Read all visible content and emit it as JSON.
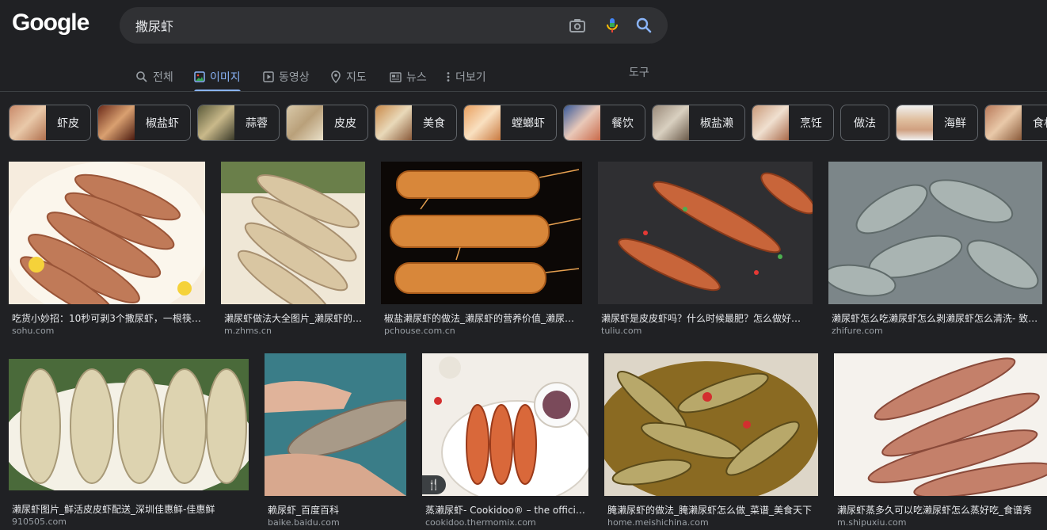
{
  "logo": "Google",
  "search": {
    "query": "撒尿虾"
  },
  "tabs": [
    {
      "label": "전체"
    },
    {
      "label": "이미지"
    },
    {
      "label": "동영상"
    },
    {
      "label": "지도"
    },
    {
      "label": "뉴스"
    },
    {
      "label": "더보기"
    }
  ],
  "tools": "도구",
  "chips": [
    {
      "label": "虾皮"
    },
    {
      "label": "椒盐虾"
    },
    {
      "label": "蒜蓉"
    },
    {
      "label": "皮皮"
    },
    {
      "label": "美食"
    },
    {
      "label": "螳螂虾"
    },
    {
      "label": "餐饮"
    },
    {
      "label": "椒盐濑"
    },
    {
      "label": "烹饪"
    },
    {
      "label": "做法"
    },
    {
      "label": "海鲜"
    },
    {
      "label": "食材"
    }
  ],
  "results": [
    {
      "title": "吃货小妙招：10秒可剥3个撒尿虾，一根筷…",
      "source": "sohu.com"
    },
    {
      "title": "濑尿虾做法大全图片_濑尿虾的…",
      "source": "m.zhms.cn"
    },
    {
      "title": "椒盐濑尿虾的做法_濑尿虾的营养价值_濑尿…",
      "source": "pchouse.com.cn"
    },
    {
      "title": "濑尿虾是皮皮虾吗？什么时候最肥？怎么做好…",
      "source": "tuliu.com"
    },
    {
      "title": "濑尿虾怎么吃濑尿虾怎么剥濑尿虾怎么清洗- 致…",
      "source": "zhifure.com"
    },
    {
      "title": "濑尿虾图片_鲜活皮皮虾配送_深圳佳惠鲜-佳惠鲜",
      "source": "910505.com"
    },
    {
      "title": "赖尿虾_百度百科",
      "source": "baike.baidu.com"
    },
    {
      "title": "蒸濑尿虾- Cookidoo® – the official…",
      "source": "cookidoo.thermomix.com"
    },
    {
      "title": "腌濑尿虾的做法_腌濑尿虾怎么做_菜谱_美食天下",
      "source": "home.meishichina.com"
    },
    {
      "title": "濑尿虾蒸多久可以吃濑尿虾怎么蒸好吃_食谱秀",
      "source": "m.shipuxiu.com"
    }
  ],
  "colors": {
    "accent": "#8ab4f8",
    "background": "#202124",
    "searchbox": "#303134"
  }
}
